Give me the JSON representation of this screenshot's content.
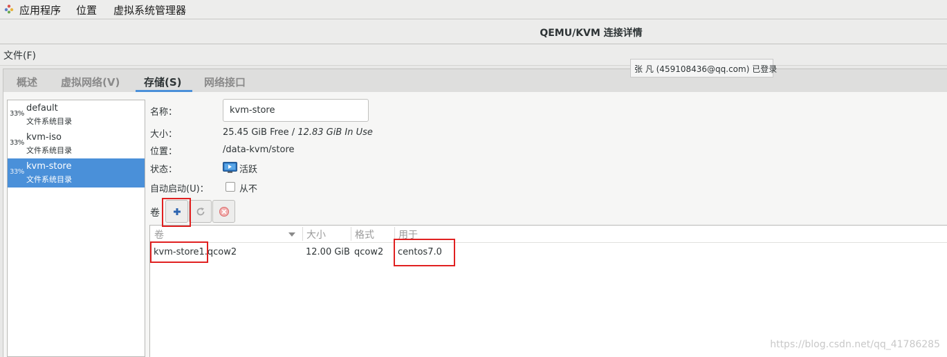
{
  "topbar": {
    "applications": "应用程序",
    "places": "位置",
    "app_name": "虚拟系统管理器"
  },
  "window": {
    "title": "QEMU/KVM 连接详情"
  },
  "menu": {
    "file": "文件(F)"
  },
  "tooltip": {
    "text": "张 凡 (459108436@qq.com) 已登录"
  },
  "tabs": [
    {
      "label": "概述",
      "active": false
    },
    {
      "label": "虚拟网络(V)",
      "active": false
    },
    {
      "label": "存储(S)",
      "active": true
    },
    {
      "label": "网络接口",
      "active": false
    }
  ],
  "pools": [
    {
      "percent": "33%",
      "name": "default",
      "type": "文件系统目录",
      "selected": false
    },
    {
      "percent": "33%",
      "name": "kvm-iso",
      "type": "文件系统目录",
      "selected": false
    },
    {
      "percent": "33%",
      "name": "kvm-store",
      "type": "文件系统目录",
      "selected": true
    }
  ],
  "details": {
    "name_label": "名称：",
    "name_value": "kvm-store",
    "size_label": "大小：",
    "size_free": "25.45 GiB Free",
    "size_sep": " / ",
    "size_used": "12.83 GiB In Use",
    "location_label": "位置：",
    "location_value": "/data-kvm/store",
    "state_label": "状态：",
    "state_value": "活跃",
    "autostart_label": "自动启动(U)：",
    "autostart_value": "从不"
  },
  "volumes": {
    "label": "卷",
    "columns": [
      "卷",
      "大小",
      "格式",
      "用于"
    ],
    "rows": [
      {
        "name": "kvm-store1.qcow2",
        "size": "12.00 GiB",
        "format": "qcow2",
        "used_by": "centos7.0"
      }
    ]
  },
  "watermark": "https://blog.csdn.net/qq_41786285",
  "colors": {
    "accent": "#4a90d9",
    "annotation": "#e02020"
  }
}
